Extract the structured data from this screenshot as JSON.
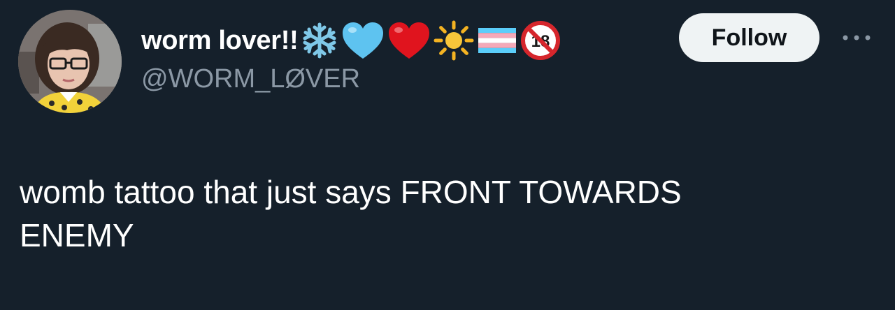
{
  "author": {
    "display_name": "worm lover!!",
    "handle": "@WORM_LØVER",
    "name_emojis": [
      "snowflake-icon",
      "light-blue-heart-icon",
      "red-heart-icon",
      "sun-icon",
      "transgender-flag-icon",
      "no-one-under-eighteen-icon"
    ],
    "no_under_18_text": "18"
  },
  "actions": {
    "follow_label": "Follow",
    "more_icon": "more-dots-icon"
  },
  "tweet": {
    "text": "womb tattoo that just says FRONT TOWARDS\nENEMY"
  },
  "colors": {
    "background": "#15202b",
    "text_primary": "#ffffff",
    "text_secondary": "#8b98a5",
    "follow_bg": "#eff3f4",
    "follow_text": "#0f1419"
  }
}
